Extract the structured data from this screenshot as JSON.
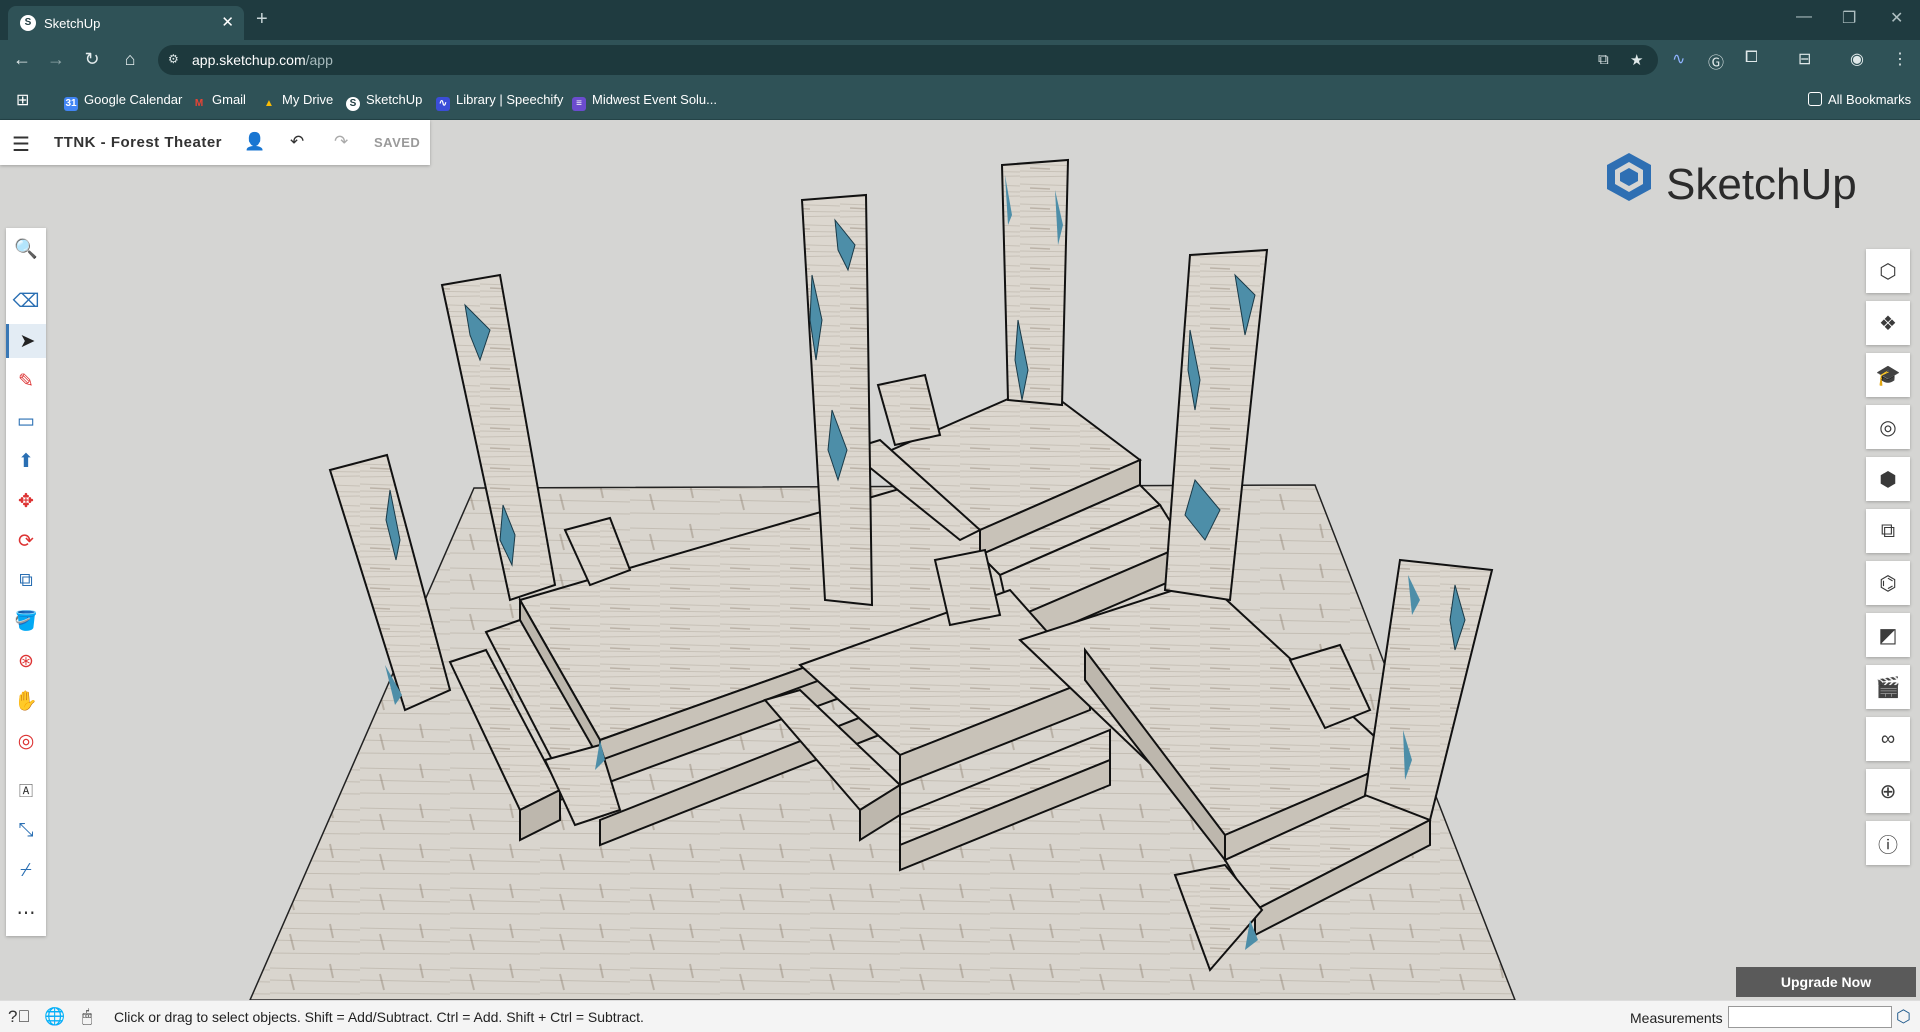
{
  "browser": {
    "tab_title": "SketchUp",
    "new_tab": "+",
    "tab_close": "✕",
    "url_host": "app.sketchup.com",
    "url_path": "/app",
    "bookmarks": [
      "Google Calendar",
      "Gmail",
      "My Drive",
      "SketchUp",
      "Library | Speechify",
      "Midwest Event Solu..."
    ],
    "all_bookmarks": "All Bookmarks"
  },
  "app": {
    "document_title": "TTNK - Forest Theater",
    "save_status": "SAVED",
    "brand": "SketchUp",
    "upgrade_label": "Upgrade Now",
    "status_text": "Click or drag to select objects. Shift = Add/Subtract. Ctrl = Add. Shift + Ctrl = Subtract.",
    "measurements_label": "Measurements",
    "measurements_value": ""
  },
  "left_tools": [
    {
      "name": "search-tool",
      "icon": "magnifier-icon"
    },
    {
      "name": "eraser-tool",
      "icon": "eraser-icon"
    },
    {
      "name": "select-tool",
      "icon": "arrow-cursor-icon",
      "active": true
    },
    {
      "name": "pencil-tool",
      "icon": "pencil-icon"
    },
    {
      "name": "rectangle-tool",
      "icon": "rectangle-icon"
    },
    {
      "name": "push-pull-tool",
      "icon": "push-pull-icon"
    },
    {
      "name": "move-tool",
      "icon": "move-icon"
    },
    {
      "name": "rotate-tool",
      "icon": "rotate-icon"
    },
    {
      "name": "scale-tool",
      "icon": "scale-icon"
    },
    {
      "name": "paint-bucket-tool",
      "icon": "paint-bucket-icon"
    },
    {
      "name": "orbit-tool",
      "icon": "orbit-icon"
    },
    {
      "name": "pan-tool",
      "icon": "hand-icon"
    },
    {
      "name": "zoom-tool",
      "icon": "zoom-pin-icon"
    },
    {
      "name": "text-tool",
      "icon": "text-label-icon"
    },
    {
      "name": "tape-measure-tool",
      "icon": "dimension-icon"
    },
    {
      "name": "eyedropper-tool",
      "icon": "eyedropper-icon"
    },
    {
      "name": "more-tools",
      "icon": "more-icon"
    }
  ],
  "right_panels": [
    "entity-info-icon",
    "components-icon",
    "instructor-icon",
    "materials-icon",
    "styles-icon",
    "tags-icon",
    "outliner-icon",
    "soften-edges-icon",
    "scenes-icon",
    "display-icon",
    "geolocation-icon",
    "info-icon"
  ],
  "colors": {
    "chrome_dark": "#1f3b40",
    "chrome": "#2f5257",
    "viewport_bg": "#d5d5d3",
    "wood": "#d9d4cc",
    "crystal": "#4d8ea8",
    "upgrade_bg": "#5a5a5a"
  }
}
